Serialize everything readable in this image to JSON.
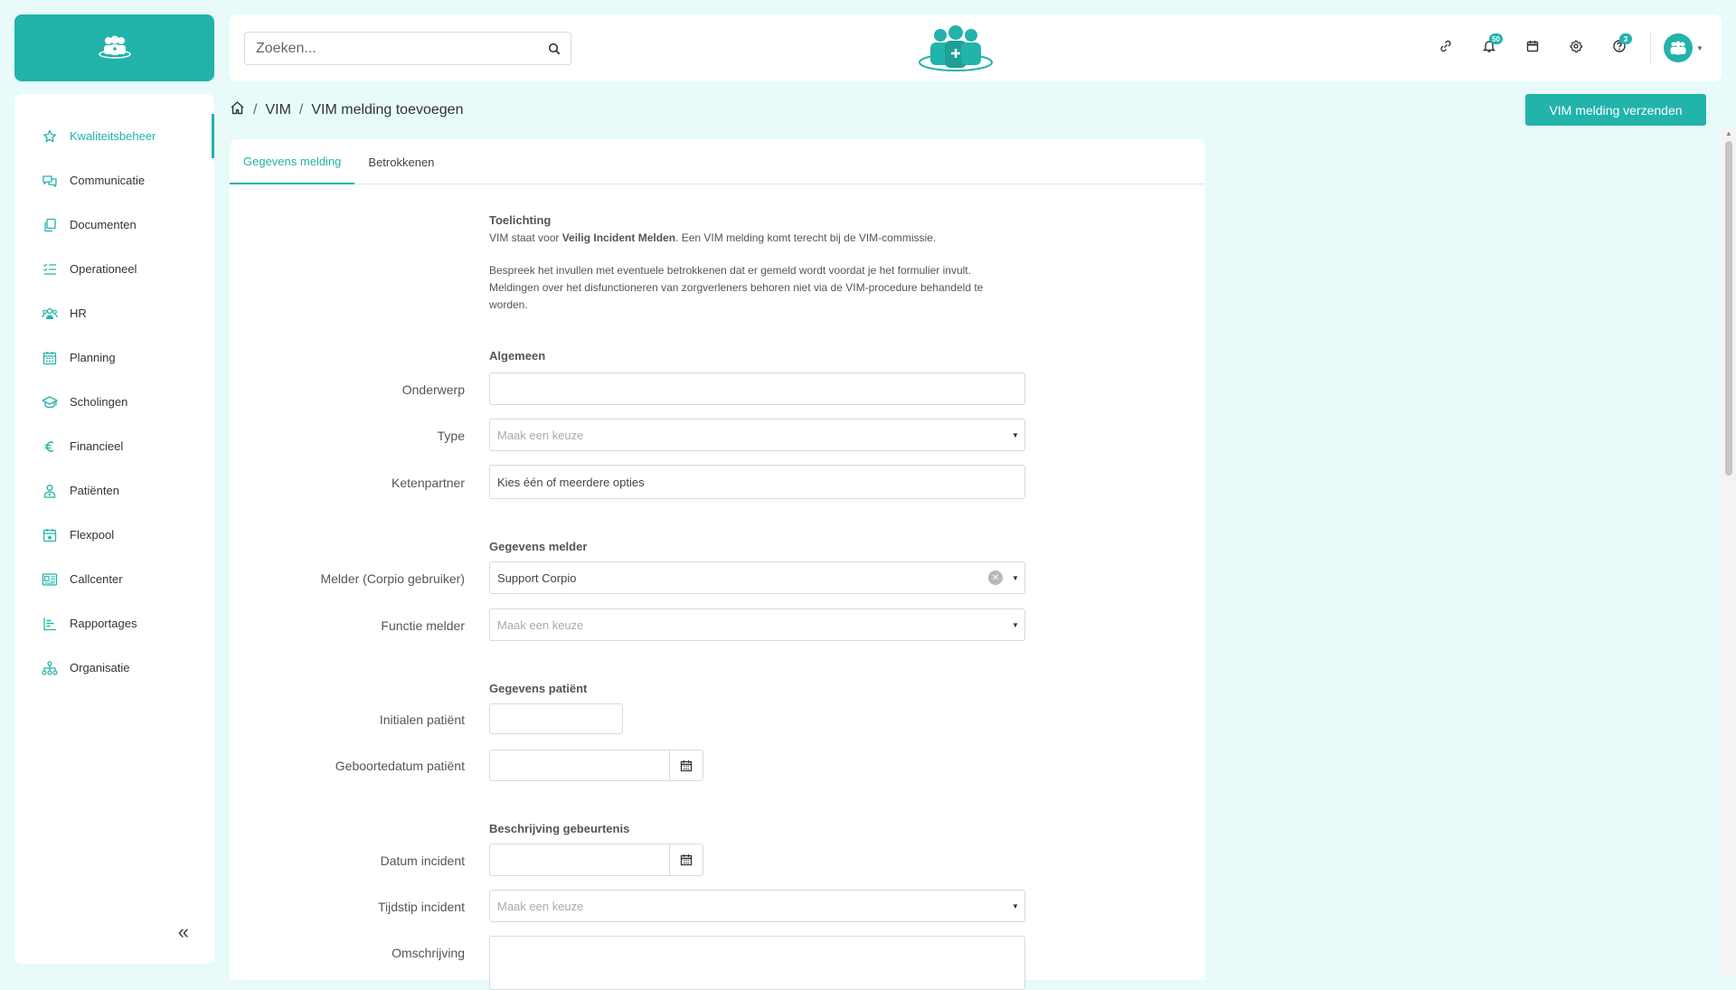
{
  "sidebar": {
    "items": [
      {
        "label": "Kwaliteitsbeheer",
        "icon": "star-icon",
        "active": true
      },
      {
        "label": "Communicatie",
        "icon": "chat-icon"
      },
      {
        "label": "Documenten",
        "icon": "documents-icon"
      },
      {
        "label": "Operationeel",
        "icon": "checklist-icon"
      },
      {
        "label": "HR",
        "icon": "people-icon"
      },
      {
        "label": "Planning",
        "icon": "calendar-icon"
      },
      {
        "label": "Scholingen",
        "icon": "graduation-cap-icon"
      },
      {
        "label": "Financieel",
        "icon": "euro-icon"
      },
      {
        "label": "Patiënten",
        "icon": "patient-icon"
      },
      {
        "label": "Flexpool",
        "icon": "calendar-star-icon"
      },
      {
        "label": "Callcenter",
        "icon": "contact-card-icon"
      },
      {
        "label": "Rapportages",
        "icon": "bar-chart-icon"
      },
      {
        "label": "Organisatie",
        "icon": "org-chart-icon"
      }
    ],
    "collapse_label": "«"
  },
  "header": {
    "search_placeholder": "Zoeken...",
    "notifications_count": "50",
    "help_count": "3",
    "accent": "#22b3ab"
  },
  "breadcrumb": {
    "level1": "VIM",
    "level2": "VIM melding toevoegen",
    "separator": "/"
  },
  "actions": {
    "submit_label": "VIM melding verzenden"
  },
  "tabs": [
    {
      "label": "Gegevens melding",
      "active": true
    },
    {
      "label": "Betrokkenen"
    }
  ],
  "form": {
    "toelichting_title": "Toelichting",
    "intro_prefix": "VIM staat voor ",
    "intro_bold": "Veilig Incident Melden",
    "intro_suffix": ". Een VIM melding komt terecht bij de VIM-commissie.",
    "intro_p2": "Bespreek het invullen met eventuele betrokkenen dat er gemeld wordt voordat je het formulier invult. Meldingen over het disfunctioneren van zorgverleners behoren niet via de VIM-procedure behandeld te worden.",
    "section_algemeen": "Algemeen",
    "label_onderwerp": "Onderwerp",
    "label_type": "Type",
    "type_placeholder": "Maak een keuze",
    "label_ketenpartner": "Ketenpartner",
    "ketenpartner_placeholder": "Kies één of meerdere opties",
    "section_melder": "Gegevens melder",
    "label_melder": "Melder (Corpio gebruiker)",
    "melder_value": "Support Corpio",
    "label_functie": "Functie melder",
    "functie_placeholder": "Maak een keuze",
    "section_patient": "Gegevens patiënt",
    "label_initialen": "Initialen patiënt",
    "label_geboortedatum": "Geboortedatum patiënt",
    "section_gebeurtenis": "Beschrijving gebeurtenis",
    "label_datum": "Datum incident",
    "label_tijdstip": "Tijdstip incident",
    "tijdstip_placeholder": "Maak een keuze",
    "label_omschrijving": "Omschrijving"
  }
}
